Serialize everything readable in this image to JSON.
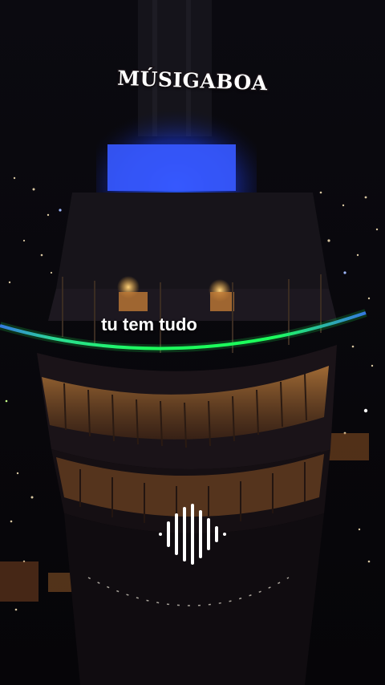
{
  "overlay": {
    "brand_text": "MÚSIGABOA",
    "lyric_text": "tu tem tudo"
  },
  "scene": {
    "subject": "aerial night view of an illuminated circular tower building over a city",
    "accent_colors": {
      "top_floodlight": "#1f4cff",
      "ring_light_green": "#1dff5c",
      "ring_light_blue": "#3b5bff",
      "window_glow": "#c8863e"
    }
  },
  "icons": {
    "audio_waveform": "audio-waveform-icon"
  }
}
